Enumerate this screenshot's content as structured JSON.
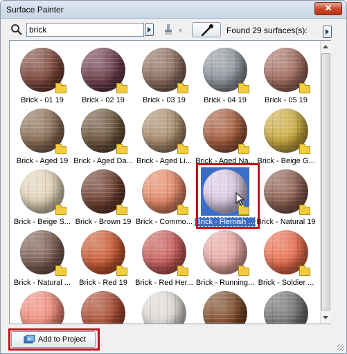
{
  "window": {
    "title": "Surface Painter",
    "close_glyph": "✕"
  },
  "search": {
    "value": "brick",
    "icon": "search-icon"
  },
  "status": {
    "found": "Found 29 surfaces(s):"
  },
  "actions": {
    "add_to_project": "Add to Project"
  },
  "selected_index": 13,
  "surfaces": [
    {
      "label": "Brick - 01 19",
      "color": "#7a4336"
    },
    {
      "label": "Brick - 02 19",
      "color": "#6b3a47"
    },
    {
      "label": "Brick - 03 19",
      "color": "#8a6a5a"
    },
    {
      "label": "Brick - 04 19",
      "color": "#8d959c"
    },
    {
      "label": "Brick - 05 19",
      "color": "#a06a5c"
    },
    {
      "label": "Brick - Aged 19",
      "color": "#8a6b52"
    },
    {
      "label": "Brick - Aged Da...",
      "color": "#6a5238"
    },
    {
      "label": "Brick - Aged Li...",
      "color": "#a88a6a"
    },
    {
      "label": "Brick - Aged Na...",
      "color": "#a35a3a"
    },
    {
      "label": "Brick - Beige G...",
      "color": "#c9a83a"
    },
    {
      "label": "Brick - Beige S...",
      "color": "#e0d2b6"
    },
    {
      "label": "Brick - Brown 19",
      "color": "#6b3a2a"
    },
    {
      "label": "Brick - Commo...",
      "color": "#e48664"
    },
    {
      "label": "Brick - Flemish ...",
      "color": "#d8c8e2"
    },
    {
      "label": "Brick - Natural 19",
      "color": "#8a5a4c"
    },
    {
      "label": "Brick - Natural ...",
      "color": "#7a5a50"
    },
    {
      "label": "Brick - Red 19",
      "color": "#c9562e"
    },
    {
      "label": "Brick - Red Her...",
      "color": "#c65a56"
    },
    {
      "label": "Brick - Running...",
      "color": "#e8a6a0"
    },
    {
      "label": "Brick - Soldier ...",
      "color": "#e86a4a"
    },
    {
      "label": "",
      "color": "#ee8876"
    },
    {
      "label": "",
      "color": "#a8462e"
    },
    {
      "label": "",
      "color": "#dcd8d4"
    },
    {
      "label": "",
      "color": "#7a4624"
    },
    {
      "label": "",
      "color": "#6e6e70"
    }
  ]
}
